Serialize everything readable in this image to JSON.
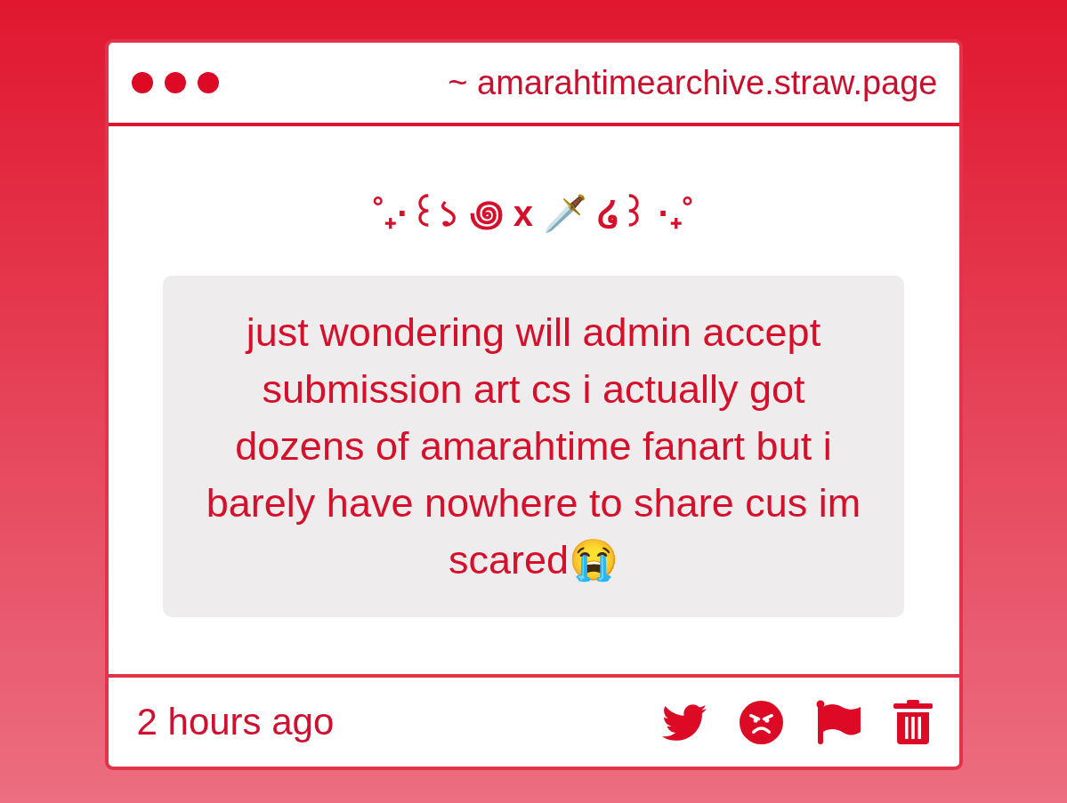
{
  "window": {
    "url": "~ amarahtimearchive.straw.page"
  },
  "post": {
    "title": "˚₊·꒰১ ꩜ x 🗡️ ໒꒱ ·₊˚",
    "message": "just wondering will admin accept submission art cs i actually got dozens of amarahtime fanart but i barely have nowhere to share cus im scared😭"
  },
  "footer": {
    "time": "2 hours ago"
  }
}
